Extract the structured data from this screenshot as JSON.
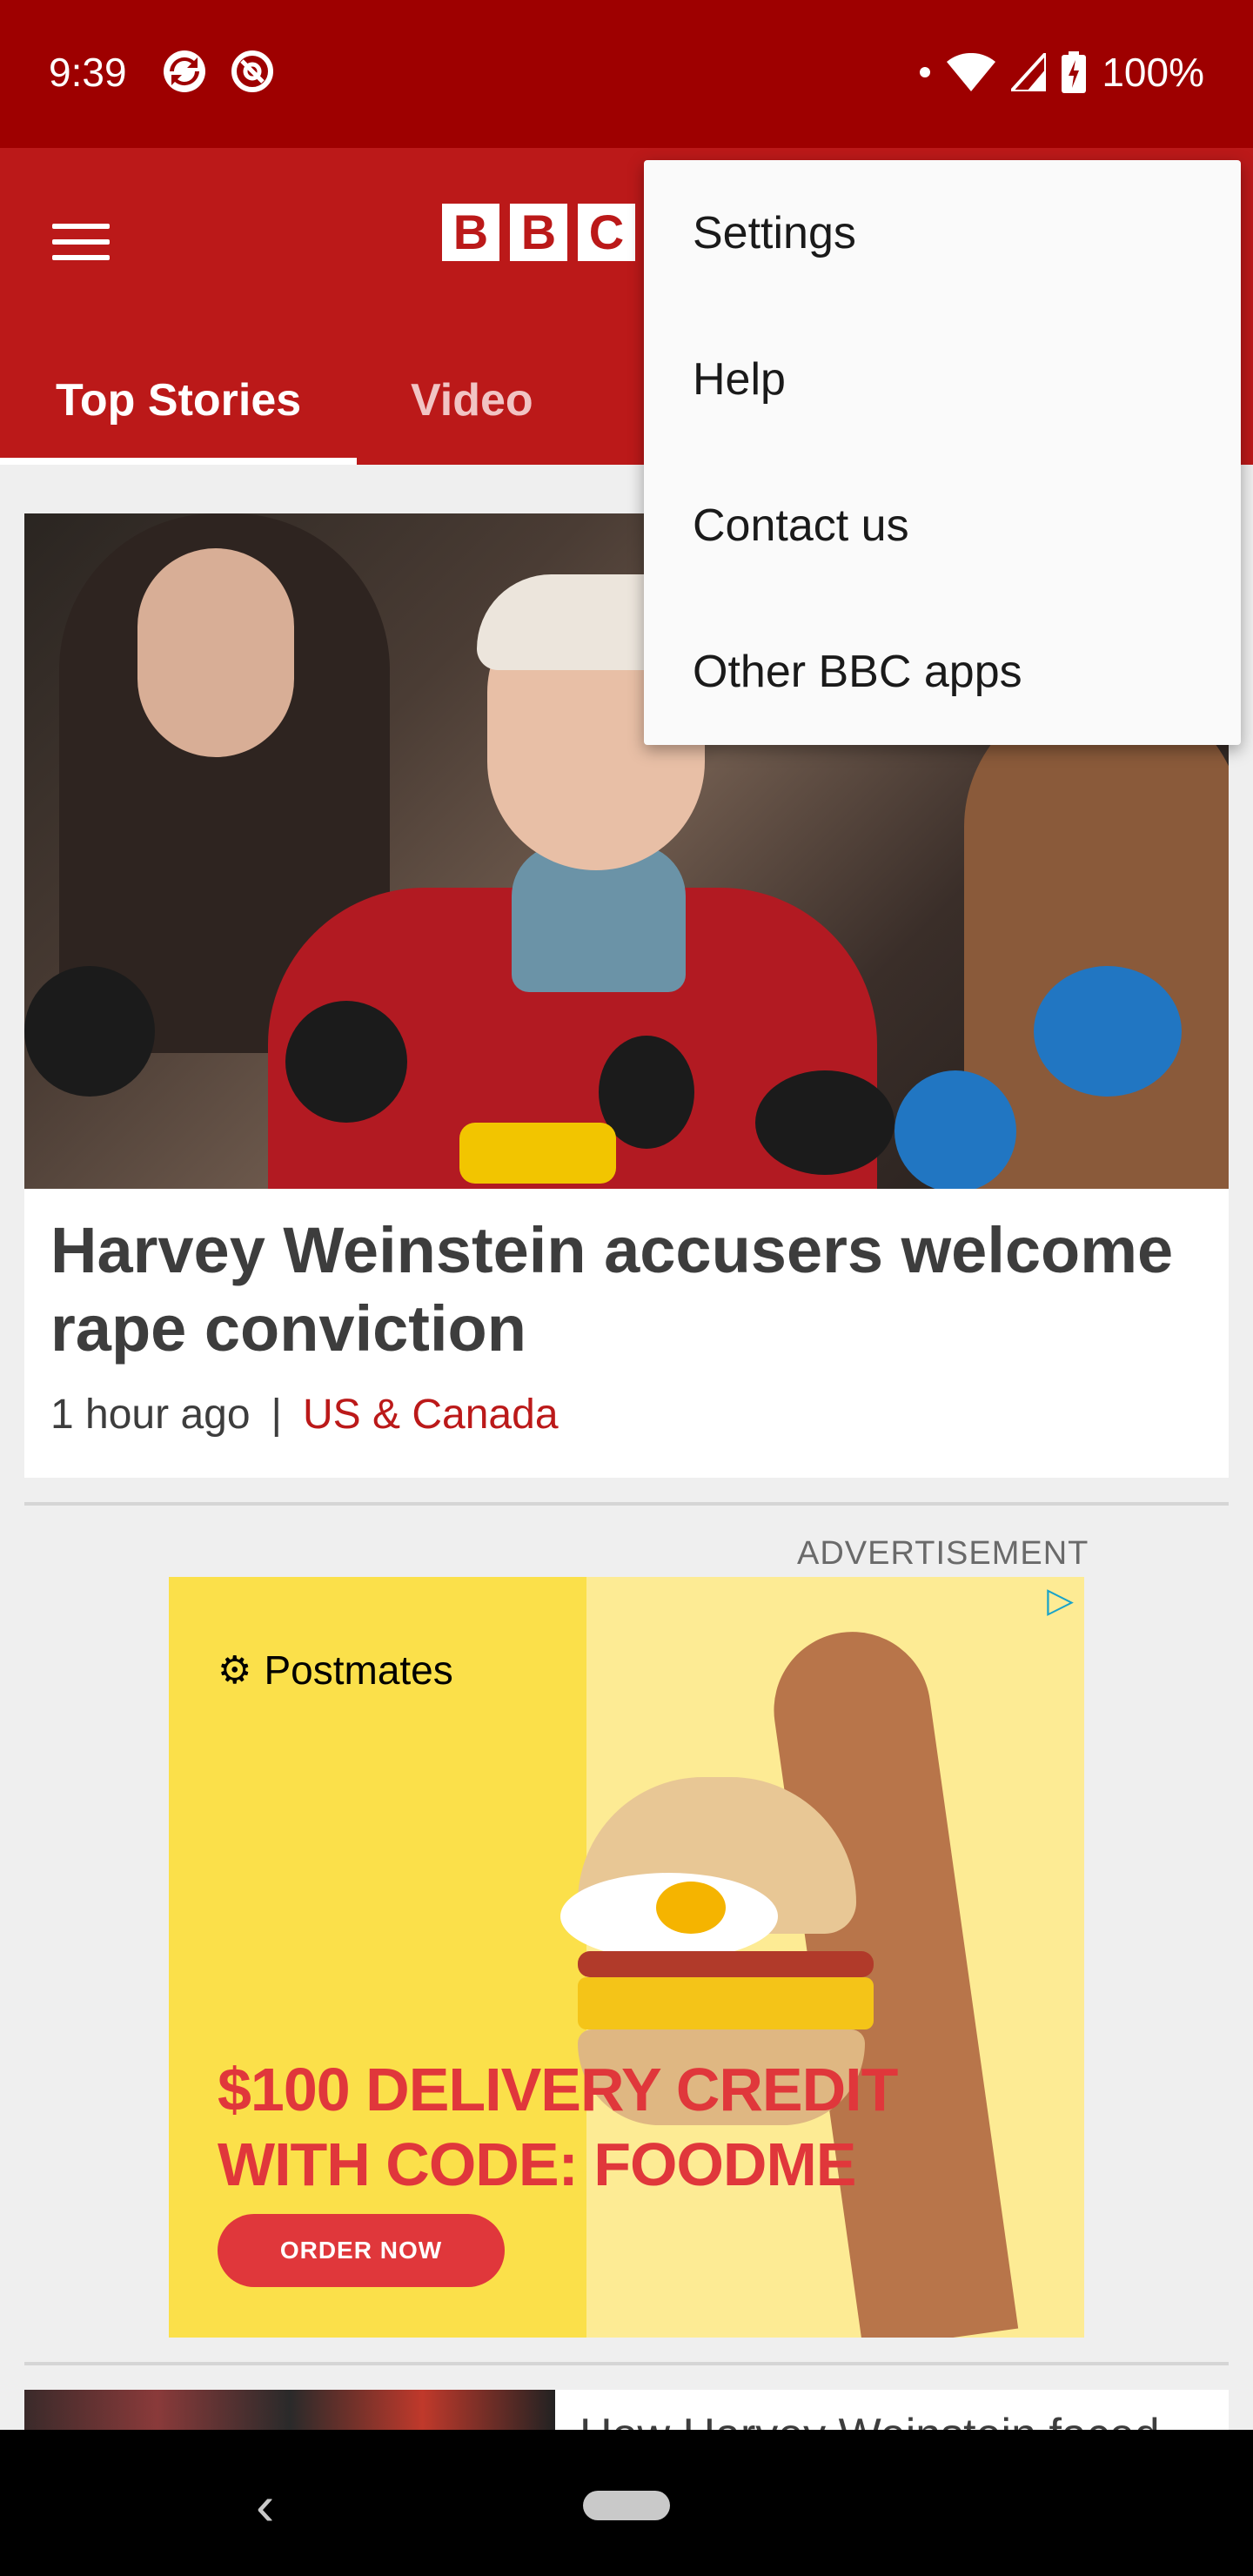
{
  "status_bar": {
    "time": "9:39",
    "battery": "100%",
    "icons": [
      "sync-icon",
      "at-icon",
      "dot-icon",
      "wifi-icon",
      "signal-icon",
      "battery-icon"
    ]
  },
  "app_bar": {
    "logo_letters": [
      "B",
      "B",
      "C"
    ],
    "tabs": [
      {
        "label": "Top Stories",
        "selected": true
      },
      {
        "label": "Video",
        "selected": false
      }
    ]
  },
  "overflow_menu": {
    "items": [
      "Settings",
      "Help",
      "Contact us",
      "Other BBC apps"
    ]
  },
  "story": {
    "headline": "Harvey Weinstein accusers welcome rape conviction",
    "time_ago": "1 hour ago",
    "separator": "|",
    "section": "US & Canada"
  },
  "ad": {
    "label": "ADVERTISEMENT",
    "brand": "Postmates",
    "promo_line1": "$100 DELIVERY CREDIT",
    "promo_line2": "WITH CODE: FOODME",
    "cta": "ORDER NOW"
  },
  "next_story": {
    "title": "How Harvey Weinstein faced"
  },
  "colors": {
    "status_bar": "#9e0000",
    "brand_red": "#bb1919",
    "ad_yellow": "#fbe04a",
    "ad_red": "#e0373b"
  }
}
